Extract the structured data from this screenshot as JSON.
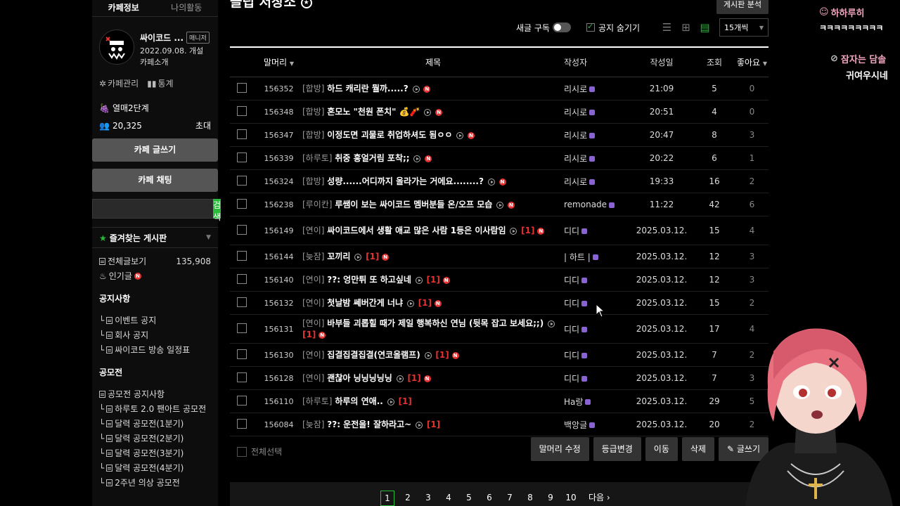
{
  "sidebar": {
    "tabs": [
      "카페정보",
      "나의활동"
    ],
    "cafe_name": "싸이코드 ...",
    "manager_badge": "매니저",
    "open_date": "2022.09.08. 개설",
    "cafe_intro": "카페소개",
    "admin_link": "카페관리",
    "stats_link": "통계",
    "level": "열매2단계",
    "member_count": "20,325",
    "invite": "초대",
    "write_button": "카페 글쓰기",
    "chat_button": "카페 채팅",
    "search_placeholder": "",
    "search_button": "검색",
    "favorites_title": "즐겨찾는 게시판",
    "all_posts_label": "전체글보기",
    "all_posts_count": "135,908",
    "popular_label": "인기글",
    "notice_title": "공지사항",
    "notice_items": [
      "이벤트 공지",
      "회사 공지",
      "싸이코드 방송 일정표"
    ],
    "contest_title": "공모전",
    "contest_items": [
      "공모전 공지사항",
      "하루토 2.0 팬아트 공모전",
      "달력 공모전(1분기)",
      "달력 공모전(2분기)",
      "달력 공모전(3분기)",
      "달력 공모전(4분기)",
      "2주년 의상 공모전"
    ]
  },
  "board": {
    "title": "클립 저장소",
    "analysis_button": "게시판 분석",
    "new_sub_label": "새글 구독",
    "hide_notice_label": "공지 숨기기",
    "per_page": "15개씩",
    "columns": {
      "prefix": "말머리",
      "title": "제목",
      "author": "작성자",
      "date": "작성일",
      "views": "조회",
      "likes": "좋아요"
    },
    "rows": [
      {
        "id": "156352",
        "prefix": "[합방]",
        "title": "하드 캐리란 뭘까.....?",
        "comments": "",
        "new": true,
        "author": "리시로",
        "date": "21:09",
        "views": "5",
        "likes": "0"
      },
      {
        "id": "156348",
        "prefix": "[합방]",
        "title": "혼모노 \"천원 폰치\" 💰🧨",
        "comments": "",
        "new": true,
        "author": "리시로",
        "date": "20:51",
        "views": "4",
        "likes": "0"
      },
      {
        "id": "156347",
        "prefix": "[합방]",
        "title": "이정도면 괴물로 취업하셔도 됨ㅇㅇ",
        "comments": "",
        "new": true,
        "author": "리시로",
        "date": "20:47",
        "views": "8",
        "likes": "3"
      },
      {
        "id": "156339",
        "prefix": "[하루토]",
        "title": "취중 흥얼거림 포착;;",
        "comments": "",
        "new": true,
        "author": "리시로",
        "date": "20:22",
        "views": "6",
        "likes": "1"
      },
      {
        "id": "156324",
        "prefix": "[합방]",
        "title": "성량......어디까지 올라가는 거에요........?",
        "comments": "",
        "new": true,
        "author": "리시로",
        "date": "19:33",
        "views": "16",
        "likes": "2"
      },
      {
        "id": "156238",
        "prefix": "[루이칸]",
        "title": "루쌤이 보는 싸이코드 멤버분들 온/오프 모습",
        "comments": "",
        "new": true,
        "author": "remonade",
        "date": "11:22",
        "views": "42",
        "likes": "6"
      },
      {
        "id": "156149",
        "prefix": "[연이]",
        "title": "싸이코드에서 생활 애교 많은 사람 1등은 이사람임",
        "comments": "[1]",
        "new": true,
        "author": "디디",
        "date": "2025.03.12.",
        "views": "15",
        "likes": "4"
      },
      {
        "id": "156144",
        "prefix": "[늦잠]",
        "title": "꼬끼리",
        "comments": "[1]",
        "new": true,
        "author": "| 하트 |",
        "date": "2025.03.12.",
        "views": "12",
        "likes": "3"
      },
      {
        "id": "156140",
        "prefix": "[연이]",
        "title": "??: 엉만튀 또 하고싶네",
        "comments": "[1]",
        "new": true,
        "author": "디디",
        "date": "2025.03.12.",
        "views": "12",
        "likes": "3"
      },
      {
        "id": "156132",
        "prefix": "[연이]",
        "title": "첫날밤 쎄버간게 너냐",
        "comments": "[1]",
        "new": true,
        "author": "디디",
        "date": "2025.03.12.",
        "views": "15",
        "likes": "2"
      },
      {
        "id": "156131",
        "prefix": "[연이]",
        "title": "바부들 괴롭힐 때가 제일 행복하신 연님 (뒷목 잡고 보세요;;)",
        "comments": "[1]",
        "new": true,
        "author": "디디",
        "date": "2025.03.12.",
        "views": "17",
        "likes": "4"
      },
      {
        "id": "156130",
        "prefix": "[연이]",
        "title": "집결집결집결(연코올램프)",
        "comments": "[1]",
        "new": true,
        "author": "디디",
        "date": "2025.03.12.",
        "views": "7",
        "likes": "2"
      },
      {
        "id": "156128",
        "prefix": "[연이]",
        "title": "괜찮아 닝닝닝닝닝",
        "comments": "[1]",
        "new": true,
        "author": "디디",
        "date": "2025.03.12.",
        "views": "7",
        "likes": "3"
      },
      {
        "id": "156110",
        "prefix": "[하루토]",
        "title": "하루의 연애..",
        "comments": "[1]",
        "new": false,
        "author": "Ha랑",
        "date": "2025.03.12.",
        "views": "29",
        "likes": "5"
      },
      {
        "id": "156084",
        "prefix": "[늦잠]",
        "title": "??: 운전을! 잘하라고~",
        "comments": "[1]",
        "new": false,
        "author": "백앙글",
        "date": "2025.03.12.",
        "views": "20",
        "likes": "2"
      }
    ],
    "select_all": "전체선택",
    "actions": [
      "말머리 수정",
      "등급변경",
      "이동",
      "삭제",
      "글쓰기"
    ],
    "pages": [
      "1",
      "2",
      "3",
      "4",
      "5",
      "6",
      "7",
      "8",
      "9",
      "10"
    ],
    "next_label": "다음"
  },
  "overlay": {
    "chat1_name": "하하루히",
    "chat1_msg": "ㅋㅋㅋㅋㅋㅋㅋㅋㅋ",
    "chat2_name": "잠자는 담솔",
    "chat2_msg": "귀여우시네"
  }
}
